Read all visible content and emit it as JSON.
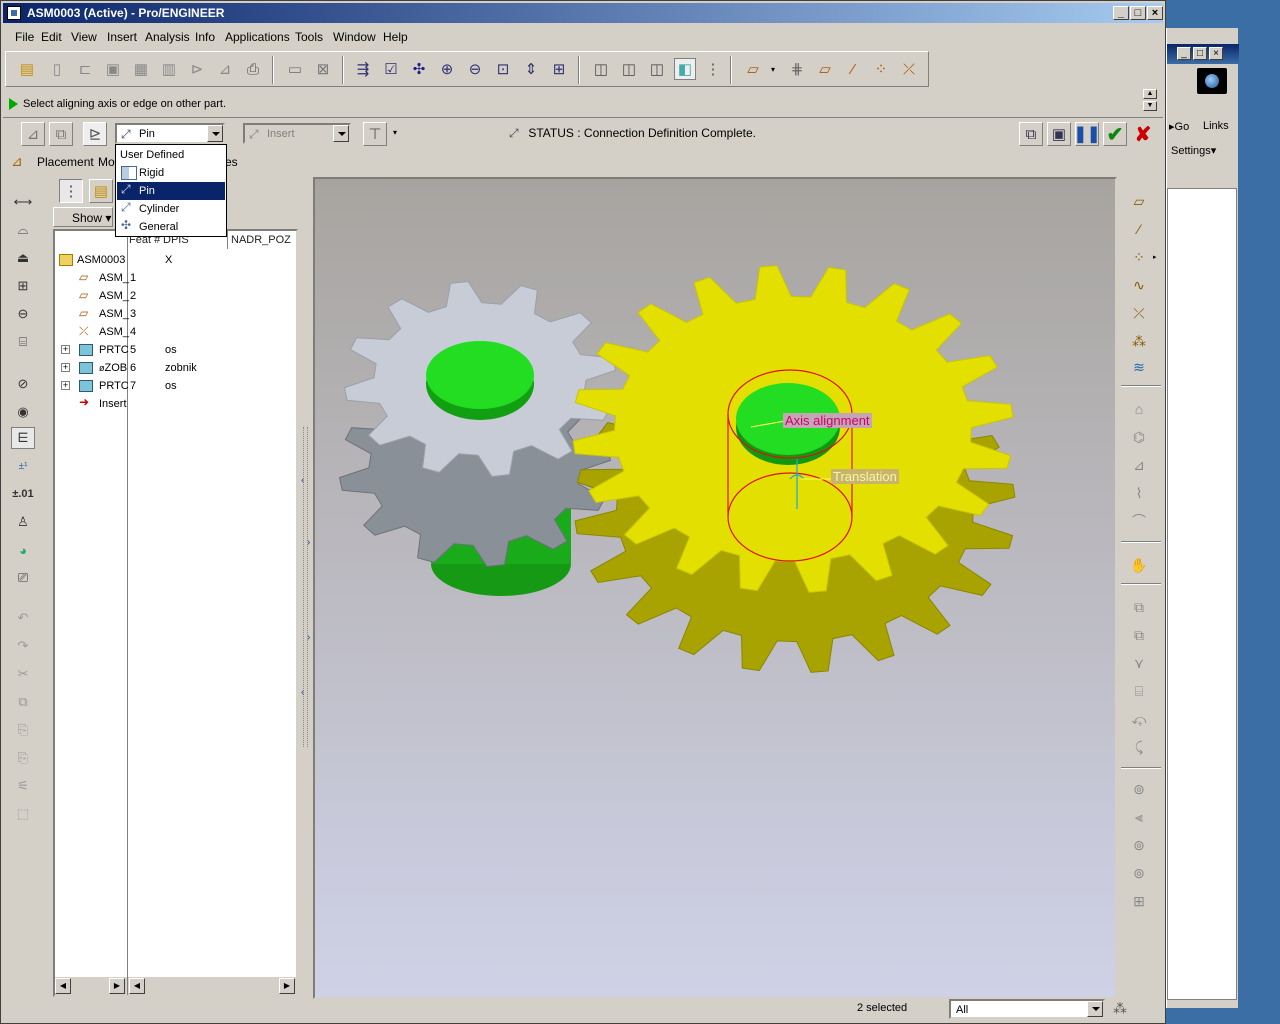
{
  "window": {
    "title": "ASM0003 (Active) - Pro/ENGINEER",
    "controls": [
      "_",
      "□",
      "×"
    ]
  },
  "menu": [
    "File",
    "Edit",
    "View",
    "Insert",
    "Analysis",
    "Info",
    "Applications",
    "Tools",
    "Window",
    "Help"
  ],
  "message": "Select aligning axis or edge on other part.",
  "dashboard": {
    "connection_type": "Pin",
    "insert_combo": "Insert",
    "status": "STATUS : Connection Definition Complete."
  },
  "dropdown": {
    "header": "User Defined",
    "options": [
      "Rigid",
      "Pin",
      "Cylinder",
      "General"
    ],
    "selected": "Pin"
  },
  "tabs": {
    "placement": "Placement",
    "move_partial": "Mo",
    "properties_partial": "es"
  },
  "tree": {
    "show_button": "Show",
    "columns": [
      "Feat #",
      "DPIS",
      "NADR_POZ"
    ],
    "rows": [
      {
        "name": "ASM0003",
        "num": "",
        "val": "X",
        "icon": "assembly"
      },
      {
        "name": "ASM_",
        "num": "1",
        "val": "",
        "icon": "datum-plane"
      },
      {
        "name": "ASM_",
        "num": "2",
        "val": "",
        "icon": "datum-plane"
      },
      {
        "name": "ASM_",
        "num": "3",
        "val": "",
        "icon": "datum-plane"
      },
      {
        "name": "ASM_",
        "num": "4",
        "val": "",
        "icon": "csys"
      },
      {
        "name": "PRTC",
        "num": "5",
        "val": "os",
        "icon": "part",
        "expandable": true
      },
      {
        "name": "ZOB",
        "num": "6",
        "val": "zobnik",
        "icon": "part",
        "expandable": true
      },
      {
        "name": "PRTC",
        "num": "7",
        "val": "os",
        "icon": "part",
        "expandable": true
      },
      {
        "name": "Insert",
        "num": "",
        "val": "",
        "icon": "insert-arrow"
      }
    ]
  },
  "viewport": {
    "labels": {
      "axis_alignment": "Axis alignment",
      "translation": "Translation"
    },
    "colors": {
      "gear_large": "#e0dc00",
      "gear_small": "#c4cad4",
      "shaft": "#22cc22",
      "constraint": "#e01010"
    }
  },
  "bottom": {
    "selected_count": "2 selected",
    "filter": "All"
  },
  "background_window": {
    "go": "Go",
    "links": "Links",
    "settings": "Settings"
  },
  "colors": {
    "titlebar_start": "#0a246a",
    "titlebar_end": "#a6caf0",
    "selection": "#0a246a",
    "chrome": "#d4d0c8",
    "accept_green": "#0a8a0a",
    "cancel_red": "#cc0000"
  }
}
